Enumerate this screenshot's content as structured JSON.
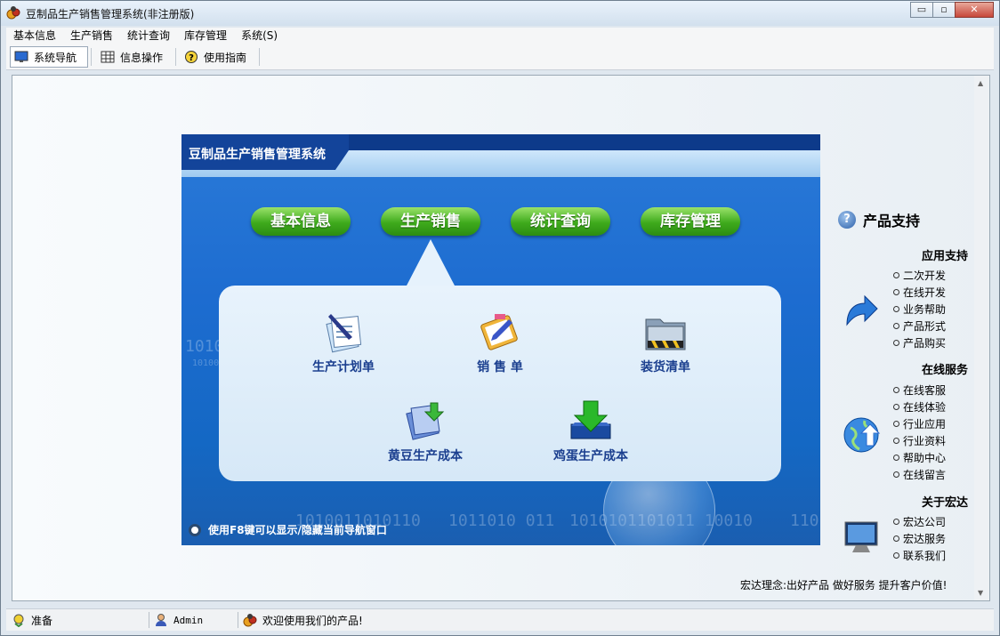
{
  "window": {
    "title": "豆制品生产销售管理系统(非注册版)",
    "controls": {
      "minimize": "▭",
      "maximize": "▫",
      "close": "✕"
    }
  },
  "menubar": {
    "items": [
      "基本信息",
      "生产销售",
      "统计查询",
      "库存管理",
      "系统(S)"
    ]
  },
  "toolbar": {
    "nav_label": "系统导航",
    "info_label": "信息操作",
    "guide_label": "使用指南"
  },
  "panel": {
    "title": "豆制品生产销售管理系统",
    "tabs": [
      "基本信息",
      "生产销售",
      "统计查询",
      "库存管理"
    ],
    "active_tab": "生产销售",
    "items": [
      {
        "label": "生产计划单",
        "icon": "document-pen-icon"
      },
      {
        "label": "销 售 单",
        "icon": "clipboard-pencil-icon"
      },
      {
        "label": "装货清单",
        "icon": "folder-icon"
      },
      {
        "label": "黄豆生产成本",
        "icon": "document-down-arrow-icon"
      },
      {
        "label": "鸡蛋生产成本",
        "icon": "green-down-arrow-icon"
      }
    ],
    "hint": "使用F8键可以显示/隐藏当前导航窗口",
    "background_text": [
      "1010",
      "10100",
      "1010011010110",
      "1011010 011",
      "1010101101011 10010",
      "110"
    ]
  },
  "support": {
    "title": "产品支持",
    "sections": [
      {
        "title": "应用支持",
        "icon": "blue-curved-arrow-icon",
        "links": [
          "二次开发",
          "在线开发",
          "业务帮助",
          "产品形式",
          "产品购买"
        ]
      },
      {
        "title": "在线服务",
        "icon": "globe-arrow-icon",
        "links": [
          "在线客服",
          "在线体验",
          "行业应用",
          "行业资料",
          "帮助中心",
          "在线留言"
        ]
      },
      {
        "title": "关于宏达",
        "icon": "monitor-icon",
        "links": [
          "宏达公司",
          "宏达服务",
          "联系我们"
        ]
      }
    ],
    "motto": "宏达理念:出好产品 做好服务 提升客户价值!"
  },
  "statusbar": {
    "ready": "准备",
    "user": "Admin",
    "welcome": "欢迎使用我们的产品!"
  },
  "colors": {
    "panel_blue": "#1d6cd0",
    "header_dark": "#0d3a8a",
    "button_green": "#3eaa1c",
    "label_blue": "#1b3f8f"
  }
}
